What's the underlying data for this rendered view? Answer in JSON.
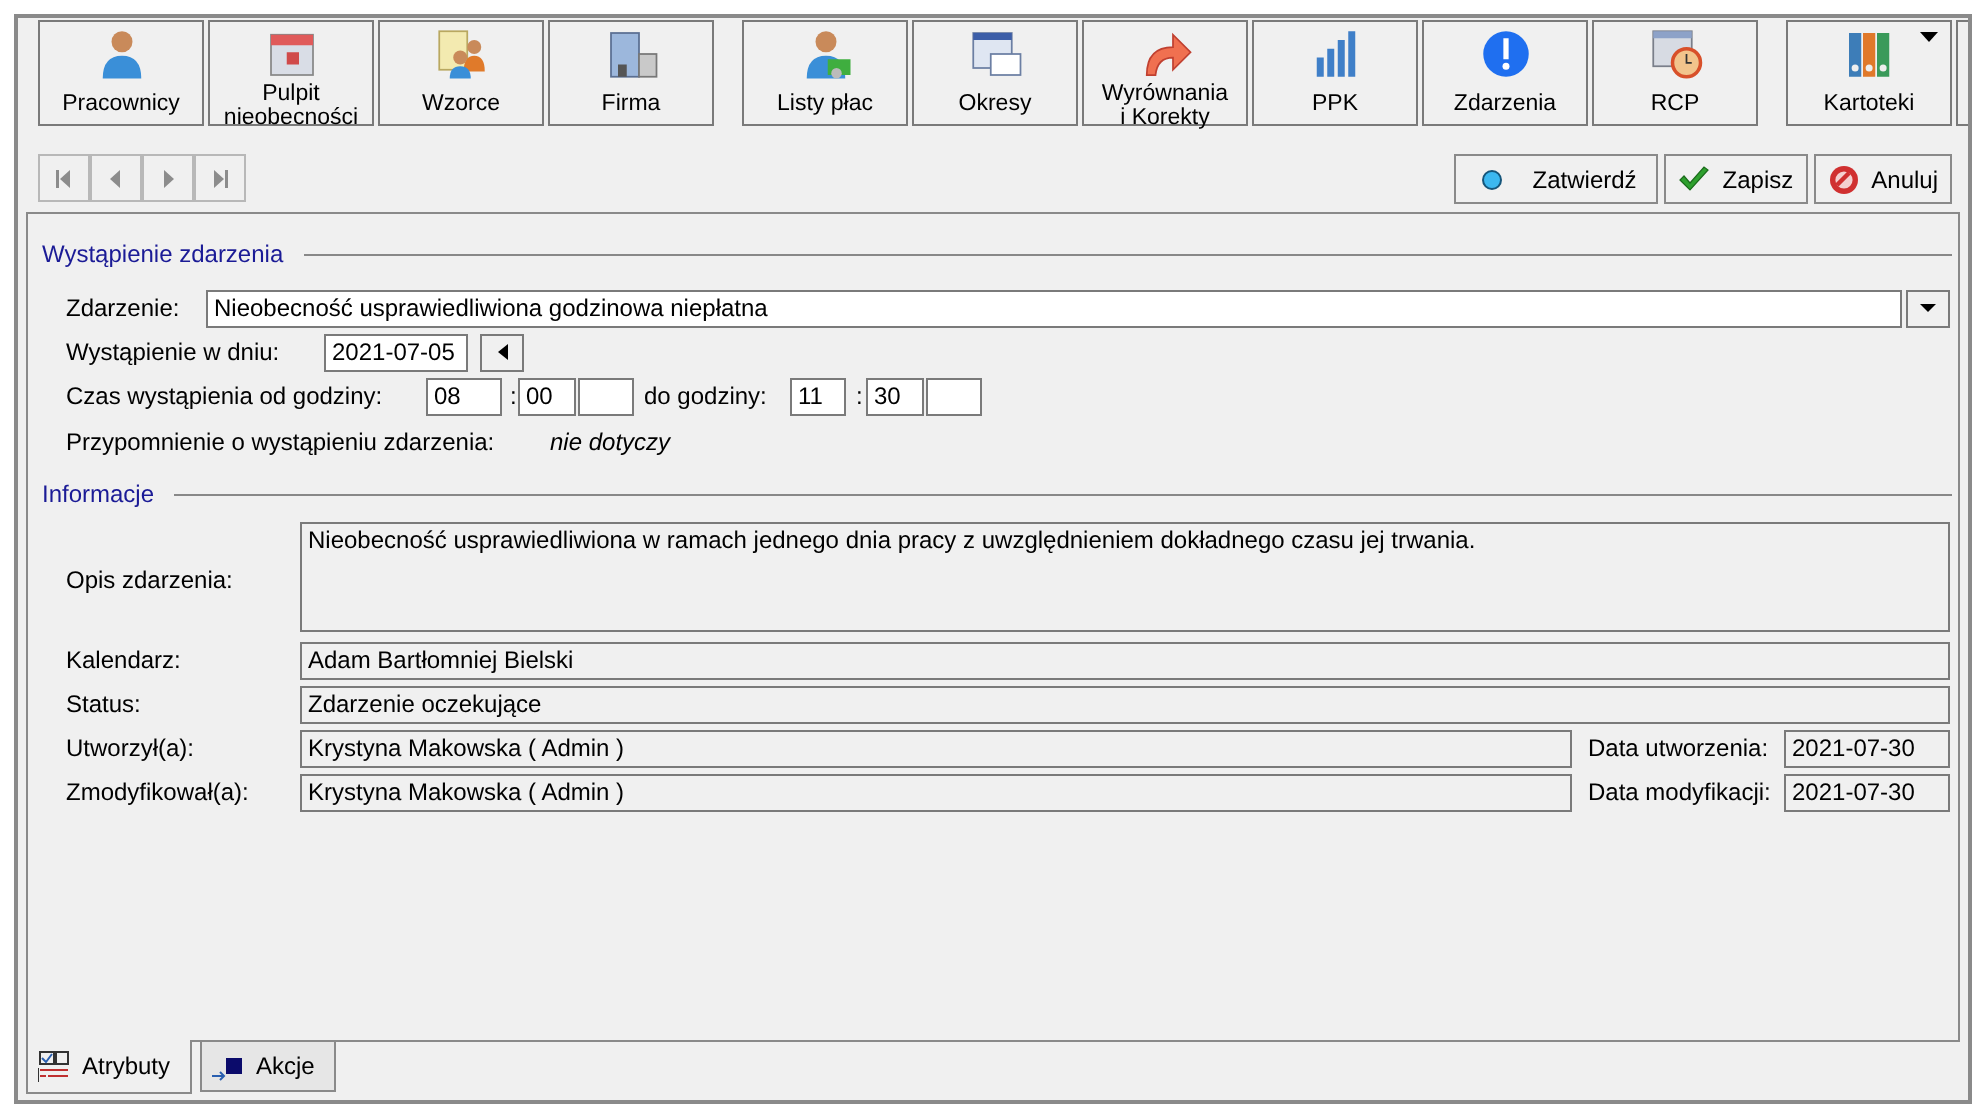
{
  "toolbar": {
    "groups": [
      [
        {
          "label": "Pracownicy",
          "has_menu": false
        },
        {
          "label": "Pulpit\nnieobecności",
          "has_menu": false
        },
        {
          "label": "Wzorce",
          "has_menu": false
        },
        {
          "label": "Firma",
          "has_menu": false
        }
      ],
      [
        {
          "label": "Listy płac",
          "has_menu": false
        },
        {
          "label": "Okresy",
          "has_menu": false
        },
        {
          "label": "Wyrównania\ni Korekty",
          "has_menu": false
        },
        {
          "label": "PPK",
          "has_menu": false
        },
        {
          "label": "Zdarzenia",
          "has_menu": false
        },
        {
          "label": "RCP",
          "has_menu": false
        }
      ],
      [
        {
          "label": "Kartoteki",
          "has_menu": true
        }
      ]
    ]
  },
  "navigation": [
    {
      "disabled": true
    },
    {
      "disabled": true
    },
    {
      "disabled": true
    },
    {
      "disabled": true
    }
  ],
  "actions": [
    {
      "label": "Zatwierdź"
    },
    {
      "label": "Zapisz"
    },
    {
      "label": "Anuluj"
    }
  ],
  "occurrence": {
    "title": "Wystąpienie zdarzenia",
    "event_label": "Zdarzenie:",
    "event_value": "Nieobecność usprawiedliwiona godzinowa niepłatna",
    "date_label": "Wystąpienie w dniu:",
    "date_value": "2021-07-05",
    "time_label": "Czas wystąpienia od godziny:",
    "from_hour": "08",
    "from_separator": ":",
    "from_minute": "00",
    "to_label": "do godziny:",
    "to_hour": "11",
    "to_separator": ":",
    "to_minute": "30",
    "reminder_label": "Przypomnienie o wystąpieniu zdarzenia:",
    "reminder_value": "nie dotyczy"
  },
  "information": {
    "title": "Informacje",
    "description_label": "Opis zdarzenia:",
    "description": "Nieobecność usprawiedliwiona w ramach jednego dnia pracy z uwzględnieniem dokładnego czasu jej trwania.",
    "fields": [
      {
        "label": "Kalendarz:",
        "value": "Adam Bartłomniej Bielski"
      },
      {
        "label": "Status:",
        "value": "Zdarzenie oczekujące"
      },
      {
        "label": "Utworzył(a):",
        "value": "Krystyna Makowska ( Admin )",
        "date_label": "Data utworzenia:",
        "date": "2021-07-30"
      },
      {
        "label": "Zmodyfikował(a):",
        "value": "Krystyna Makowska ( Admin )",
        "date_label": "Data modyfikacji:",
        "date": "2021-07-30"
      }
    ]
  },
  "tabs": [
    {
      "label": "Atrybuty",
      "selected": true
    },
    {
      "label": "Akcje",
      "selected": false
    }
  ]
}
